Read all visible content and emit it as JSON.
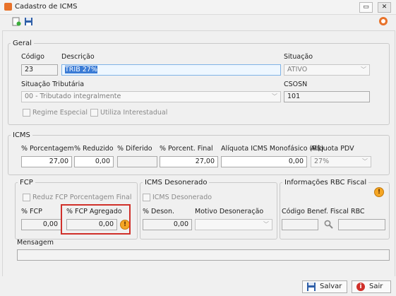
{
  "window": {
    "title": "Cadastro de ICMS"
  },
  "geral": {
    "legend": "Geral",
    "codigo_label": "Código",
    "codigo": "23",
    "descricao_label": "Descrição",
    "descricao": "TRIB 27%",
    "situacao_label": "Situação",
    "situacao": "ATIVO",
    "sit_trib_label": "Situação Tributária",
    "sit_trib": "00 - Tributado integralmente",
    "csosn_label": "CSOSN",
    "csosn": "101",
    "regime_label": "Regime Especial",
    "interestadual_label": "Utiliza Interestadual"
  },
  "icms": {
    "legend": "ICMS",
    "porcentagem_label": "% Porcentagem",
    "porcentagem": "27,00",
    "reduzido_label": "% Reduzido",
    "reduzido": "0,00",
    "diferido_label": "% Diferido",
    "diferido": "",
    "final_label": "% Porcent. Final",
    "final": "27,00",
    "monofasico_label": "Alíquota ICMS Monofásico (R$)",
    "monofasico": "0,00",
    "pdv_label": "Alíquota PDV",
    "pdv": "27%"
  },
  "fcp": {
    "legend": "FCP",
    "reduz_label": "Reduz FCP Porcentagem Final",
    "fcp_label": "% FCP",
    "fcp": "0,00",
    "agregado_label": "% FCP Agregado",
    "agregado": "0,00"
  },
  "desonerado": {
    "legend": "ICMS Desonerado",
    "check_label": "ICMS Desonerado",
    "deson_label": "% Deson.",
    "deson": "0,00",
    "motivo_label": "Motivo Desoneração",
    "motivo": ""
  },
  "rbc": {
    "legend": "Informações RBC Fiscal",
    "codigo_label": "Código Benef. Fiscal RBC"
  },
  "mensagem": {
    "label": "Mensagem",
    "value": ""
  },
  "footer": {
    "salvar": "Salvar",
    "sair": "Sair"
  },
  "colors": {
    "accent": "#3a7bd5",
    "warning": "#f5a623",
    "highlight": "#d0302a"
  }
}
